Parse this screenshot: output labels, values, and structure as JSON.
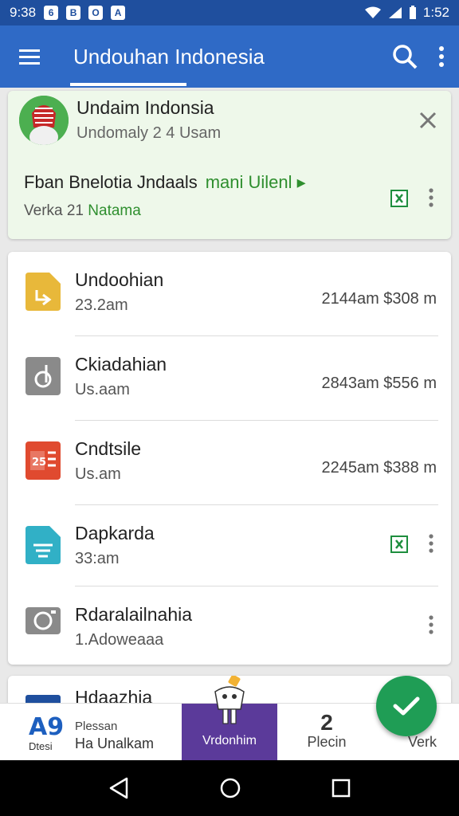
{
  "status_bar": {
    "time_left": "9:38",
    "time_right": "1:52",
    "notif_icons": [
      "6",
      "B",
      "O",
      "A"
    ]
  },
  "app_bar": {
    "title": "Undouhan Indonesia",
    "menu_icon": "menu-icon",
    "search_icon": "search-icon",
    "more_icon": "more-vert-icon"
  },
  "highlight": {
    "title": "Undaim Indonsia",
    "subtitle": "Undomaly  2 4 Usam",
    "line1_text": "Fban Bnelotia Jndaals",
    "line1_link": "mani Uilenl ▸",
    "line2_prefix": "Verka 21",
    "line2_green": "Natama"
  },
  "files": [
    {
      "name": "Undoohian",
      "sub": "23.2am",
      "meta": "2144am $308 m",
      "icon_color": "#e8b83a",
      "icon": "doc-icon",
      "show_meta": true
    },
    {
      "name": "Ckiadahian",
      "sub": "Us.aam",
      "meta": "2843am $556 m",
      "icon_color": "#8a8a8a",
      "icon": "shield-icon",
      "show_meta": true
    },
    {
      "name": "Cndtsile",
      "sub": "Us.am",
      "meta": "2245am $388 m",
      "icon_color": "#e04a2f",
      "icon": "presentation-icon",
      "show_meta": true
    },
    {
      "name": "Dapkarda",
      "sub": "33:am",
      "meta": "",
      "icon_color": "#31b0c6",
      "icon": "doc-lines-icon",
      "show_meta": false
    },
    {
      "name": "Rdaralailnahia",
      "sub": "1.Adoweaaa",
      "meta": "",
      "icon_color": "#8a8a8a",
      "icon": "camera-icon",
      "show_meta": false
    }
  ],
  "peek": {
    "name": "Hdaazhia"
  },
  "bottom_nav": {
    "item1_badge": "A9",
    "item1_label_a": "Dtesi",
    "item1_label_b": "Plessan",
    "item1_label_c": "Ha Unalkam",
    "item2_label": "Vrdonhim",
    "item3_glyph": "2",
    "item3_label": "Plecin",
    "item4_label": "Verk"
  },
  "colors": {
    "app_bar": "#2f6ac6",
    "status_bar": "#1f4f9e",
    "fab": "#1f9d55",
    "active_tab": "#5b3a9a",
    "highlight_bg": "#eef8ea"
  }
}
